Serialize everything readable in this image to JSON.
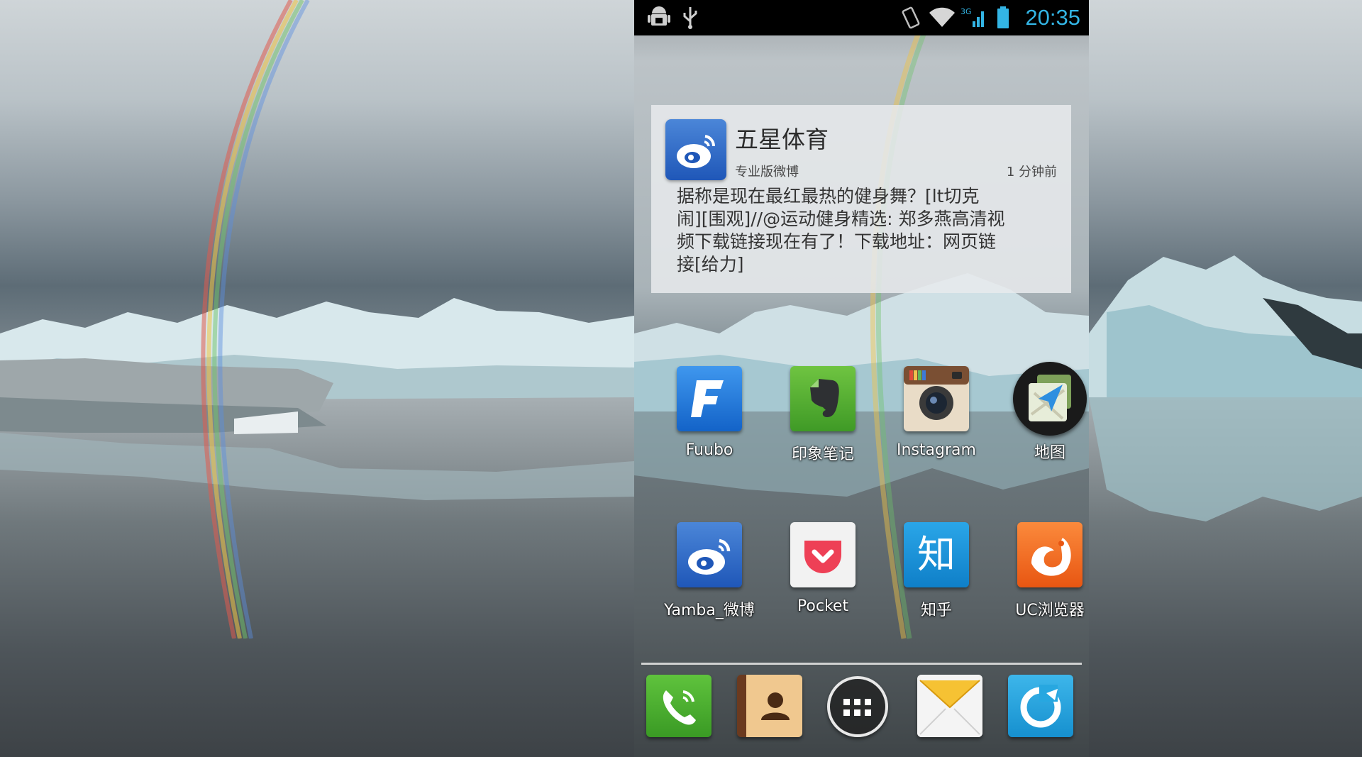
{
  "status_bar": {
    "time": "20:35",
    "network_label": "3G",
    "left_icons": [
      "android-debug-icon",
      "usb-icon"
    ],
    "right_icons": [
      "vibrate-icon",
      "wifi-icon",
      "signal-icon",
      "battery-icon"
    ]
  },
  "widget": {
    "title": "五星体育",
    "source": "专业版微博",
    "time_ago": "1 分钟前",
    "body_lines": [
      "据称是现在最红最热的健身舞？[lt切克",
      "闹][围观]//@运动健身精选: 郑多燕高清视",
      "频下载链接现在有了！下载地址：网页链",
      "接[给力]"
    ]
  },
  "apps": [
    {
      "label": "Fuubo",
      "icon": "fuubo-icon"
    },
    {
      "label": "印象笔记",
      "icon": "evernote-icon"
    },
    {
      "label": "Instagram",
      "icon": "instagram-icon"
    },
    {
      "label": "地图",
      "icon": "maps-folder-icon"
    },
    {
      "label": "Yamba_微博",
      "icon": "weibo-icon"
    },
    {
      "label": "Pocket",
      "icon": "pocket-icon"
    },
    {
      "label": "知乎",
      "icon": "zhihu-icon",
      "glyph": "知"
    },
    {
      "label": "UC浏览器",
      "icon": "uc-browser-icon"
    }
  ],
  "dock": [
    "phone-icon",
    "contacts-icon",
    "app-drawer-icon",
    "messaging-icon",
    "browser-icon"
  ],
  "colors": {
    "clock": "#33b5e5",
    "widget_bg": "#e8eaec",
    "fuubo": "#1d7be0",
    "evernote": "#59b53a",
    "pocket": "#ee4056",
    "zhihu": "#1e94d8",
    "uc": "#f2681f",
    "dock_phone": "#4cae2f",
    "dock_browser": "#27a7e0"
  }
}
